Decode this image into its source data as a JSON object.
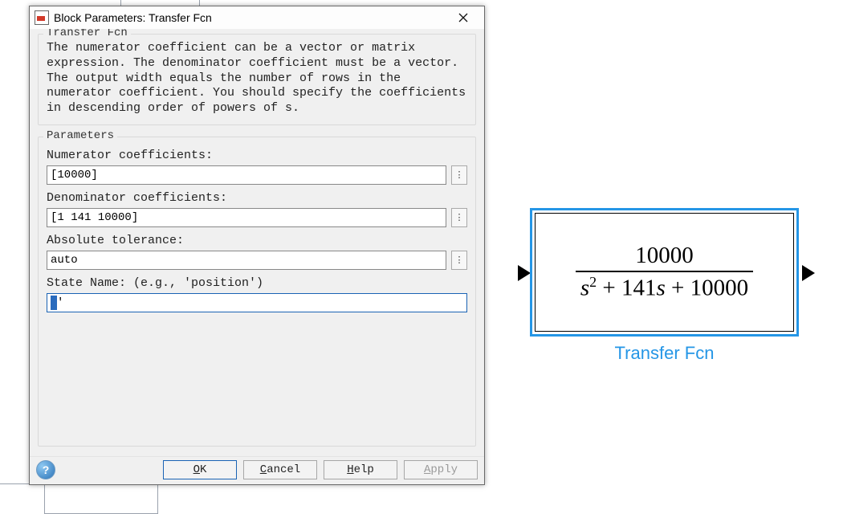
{
  "dialog": {
    "title": "Block Parameters: Transfer Fcn",
    "section1": {
      "legend": "Transfer Fcn",
      "description": "The numerator coefficient can be a vector or matrix expression. The denominator coefficient must be a vector. The output width equals the number of rows in the numerator coefficient. You should specify the coefficients in descending order of powers of s."
    },
    "params": {
      "legend": "Parameters",
      "numerator_label": "Numerator coefficients:",
      "numerator_value": "[10000]",
      "denominator_label": "Denominator coefficients:",
      "denominator_value": "[1 141 10000]",
      "abstol_label": "Absolute tolerance:",
      "abstol_value": "auto",
      "state_label": "State Name: (e.g., 'position')",
      "state_value": "''"
    },
    "buttons": {
      "ok": "OK",
      "cancel": "Cancel",
      "help": "Help",
      "apply": "Apply"
    }
  },
  "block": {
    "label": "Transfer Fcn",
    "numerator_display": "10000",
    "denominator_display_html": "s² + 141s + 10000"
  }
}
